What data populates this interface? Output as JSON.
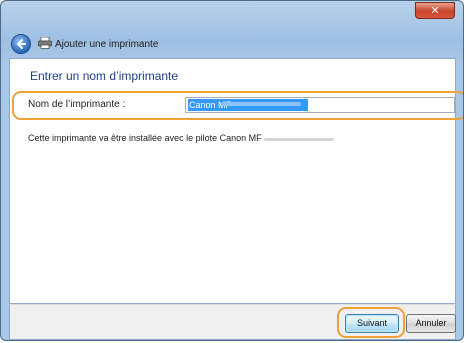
{
  "window": {
    "title": "Ajouter une imprimante",
    "close_label": "✕"
  },
  "content": {
    "heading": "Entrer un nom d’imprimante",
    "name_field": {
      "label": "Nom de l’imprimante :",
      "value": "Canon MF"
    },
    "info_text": "Cette imprimante va être installée avec le pilote Canon MF"
  },
  "buttons": {
    "next": "Suivant",
    "cancel": "Annuler"
  },
  "colors": {
    "highlight": "#f0a13a",
    "heading": "#1f3f86",
    "selection": "#3399ff"
  }
}
